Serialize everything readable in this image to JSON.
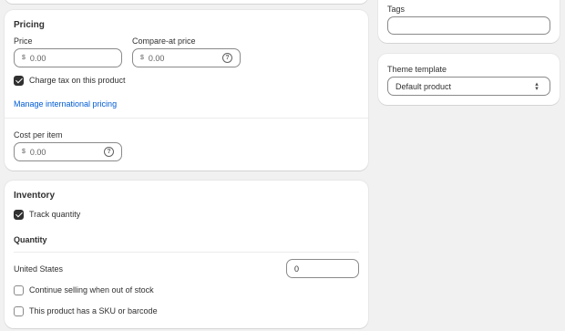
{
  "pricing": {
    "title": "Pricing",
    "price_label": "Price",
    "price_prefix": "$",
    "price_value": "0.00",
    "compare_label": "Compare-at price",
    "compare_prefix": "$",
    "compare_value": "0.00",
    "charge_tax_label": "Charge tax on this product",
    "charge_tax_checked": true,
    "international_link": "Manage international pricing",
    "cost_label": "Cost per item",
    "cost_prefix": "$",
    "cost_value": "0.00"
  },
  "inventory": {
    "title": "Inventory",
    "track_label": "Track quantity",
    "track_checked": true,
    "quantity_heading": "Quantity",
    "location_label": "United States",
    "location_quantity": "0",
    "continue_selling_label": "Continue selling when out of stock",
    "continue_selling_checked": false,
    "sku_label": "This product has a SKU or barcode",
    "sku_checked": false
  },
  "tags": {
    "label": "Tags",
    "value": ""
  },
  "theme": {
    "label": "Theme template",
    "selected": "Default product"
  },
  "icons": {
    "help": "question-circle-icon",
    "select": "chevron-up-down-icon",
    "check": "checkmark-icon"
  },
  "colors": {
    "background": "#f1f1f1",
    "card": "#ffffff",
    "link": "#005bd3",
    "checkbox_checked": "#303030"
  }
}
